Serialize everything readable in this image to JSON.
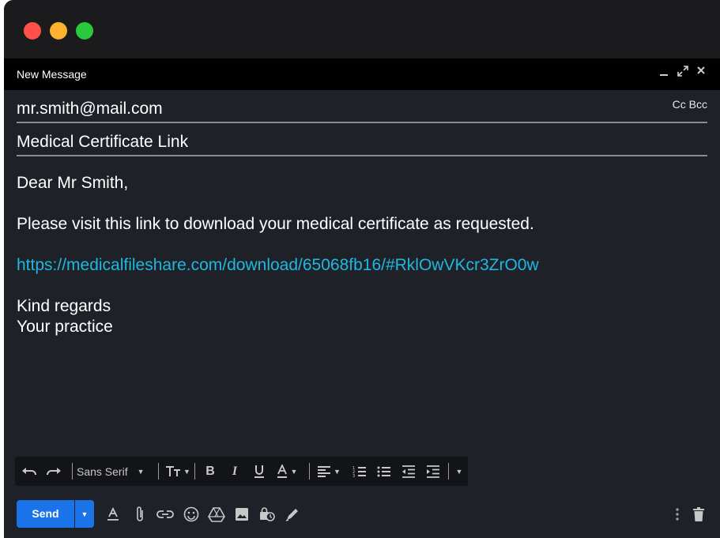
{
  "compose": {
    "title": "New Message",
    "to": "mr.smith@mail.com",
    "cc_bcc": "Cc Bcc",
    "subject": "Medical Certificate Link",
    "body": {
      "greeting": "Dear Mr Smith,",
      "line1": "Please visit this link to download your medical certificate as requested.",
      "link": "https://medicalfileshare.com/download/65068fb16/#RklOwVKcr3ZrO0w",
      "signoff": "Kind regards",
      "signature": "Your practice"
    }
  },
  "toolbar": {
    "font": "Sans Serif",
    "icons": [
      "undo-icon",
      "redo-icon",
      "font-size-icon",
      "bold-icon",
      "italic-icon",
      "underline-icon",
      "text-color-icon",
      "align-icon",
      "numbered-list-icon",
      "bulleted-list-icon",
      "indent-less-icon",
      "indent-more-icon",
      "more-formatting-icon"
    ]
  },
  "actions": {
    "send_label": "Send",
    "icons": [
      "formatting-icon",
      "attach-icon",
      "link-icon",
      "emoji-icon",
      "drive-icon",
      "photo-icon",
      "confidential-icon",
      "signature-icon",
      "more-options-icon",
      "trash-icon"
    ]
  },
  "colors": {
    "window_bg": "#1e2128",
    "header_bg": "#000000",
    "link": "#1fb8e0",
    "send_button": "#1a73e8",
    "traffic_red": "#fe4f4a",
    "traffic_yellow": "#fdb22f",
    "traffic_green": "#2ac93d"
  }
}
